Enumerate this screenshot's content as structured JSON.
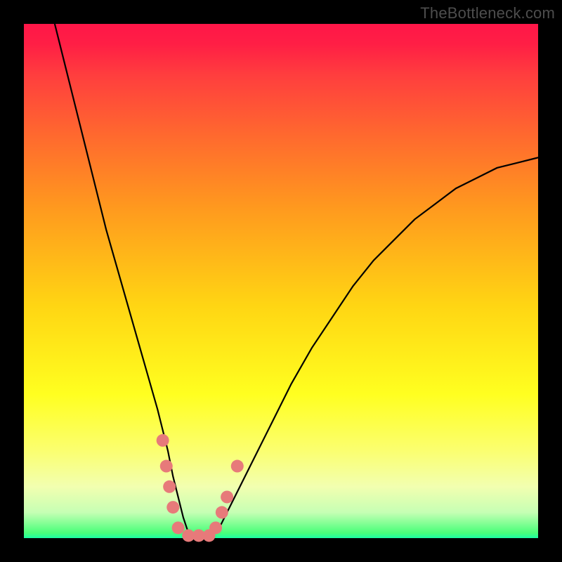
{
  "watermark": "TheBottleneck.com",
  "chart_data": {
    "type": "line",
    "title": "",
    "xlabel": "",
    "ylabel": "",
    "xlim": [
      0,
      100
    ],
    "ylim": [
      0,
      100
    ],
    "grid": false,
    "legend": false,
    "background": "rainbow-vertical-gradient",
    "series": [
      {
        "name": "curve",
        "x": [
          6,
          8,
          10,
          12,
          14,
          16,
          18,
          20,
          22,
          24,
          26,
          27,
          28,
          29,
          30,
          31,
          32,
          33,
          34,
          36,
          38,
          40,
          44,
          48,
          52,
          56,
          60,
          64,
          68,
          72,
          76,
          80,
          84,
          88,
          92,
          96,
          100
        ],
        "y": [
          100,
          92,
          84,
          76,
          68,
          60,
          53,
          46,
          39,
          32,
          25,
          21,
          17,
          12,
          8,
          4,
          1,
          0,
          0,
          0,
          2,
          6,
          14,
          22,
          30,
          37,
          43,
          49,
          54,
          58,
          62,
          65,
          68,
          70,
          72,
          73,
          74
        ],
        "color": "#000000"
      }
    ],
    "markers": [
      {
        "x": 27.0,
        "y": 19,
        "r": 9
      },
      {
        "x": 27.7,
        "y": 14,
        "r": 9
      },
      {
        "x": 28.3,
        "y": 10,
        "r": 9
      },
      {
        "x": 29.0,
        "y": 6,
        "r": 9
      },
      {
        "x": 30.0,
        "y": 2,
        "r": 9
      },
      {
        "x": 32.0,
        "y": 0.5,
        "r": 9
      },
      {
        "x": 34.0,
        "y": 0.5,
        "r": 9
      },
      {
        "x": 36.0,
        "y": 0.5,
        "r": 9
      },
      {
        "x": 37.3,
        "y": 2,
        "r": 9
      },
      {
        "x": 38.5,
        "y": 5,
        "r": 9
      },
      {
        "x": 39.5,
        "y": 8,
        "r": 9
      },
      {
        "x": 41.5,
        "y": 14,
        "r": 9
      }
    ]
  }
}
